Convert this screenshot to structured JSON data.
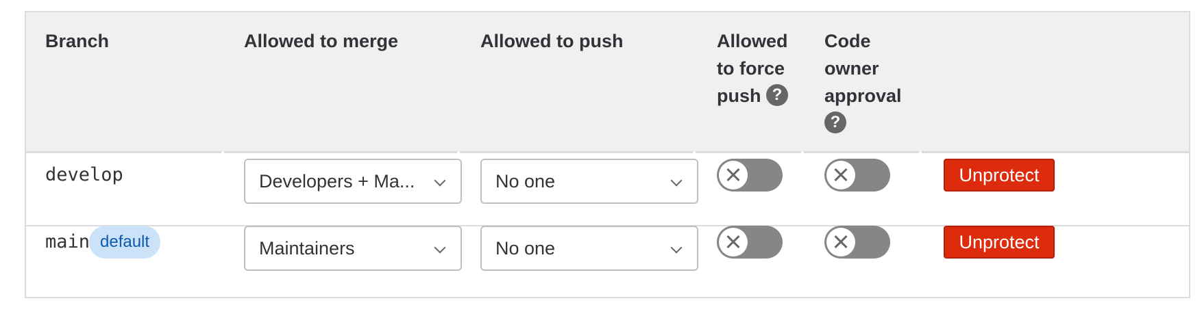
{
  "headers": {
    "branch": "Branch",
    "allowed_to_merge": "Allowed to merge",
    "allowed_to_push": "Allowed to push",
    "allowed_to_force_push": "Allowed to force push",
    "code_owner_approval": "Code owner approval",
    "help_glyph": "?"
  },
  "rows": [
    {
      "branch": "develop",
      "badge": "",
      "merge_value": "Developers + Ma...",
      "push_value": "No one",
      "force_push_enabled": false,
      "code_owner_enabled": false,
      "action_label": "Unprotect"
    },
    {
      "branch": "main",
      "badge": "default",
      "merge_value": "Maintainers",
      "push_value": "No one",
      "force_push_enabled": false,
      "code_owner_enabled": false,
      "action_label": "Unprotect"
    }
  ],
  "colors": {
    "header_bg": "#f0f0f0",
    "border": "#dcdcde",
    "toggle_off": "#868686",
    "danger": "#dd2b0e",
    "badge_bg": "#cbe2f9",
    "badge_text": "#0b5cad"
  },
  "icons": {
    "help": "question-circle-icon",
    "dropdown": "chevron-down-icon",
    "toggle_off": "close-icon"
  }
}
